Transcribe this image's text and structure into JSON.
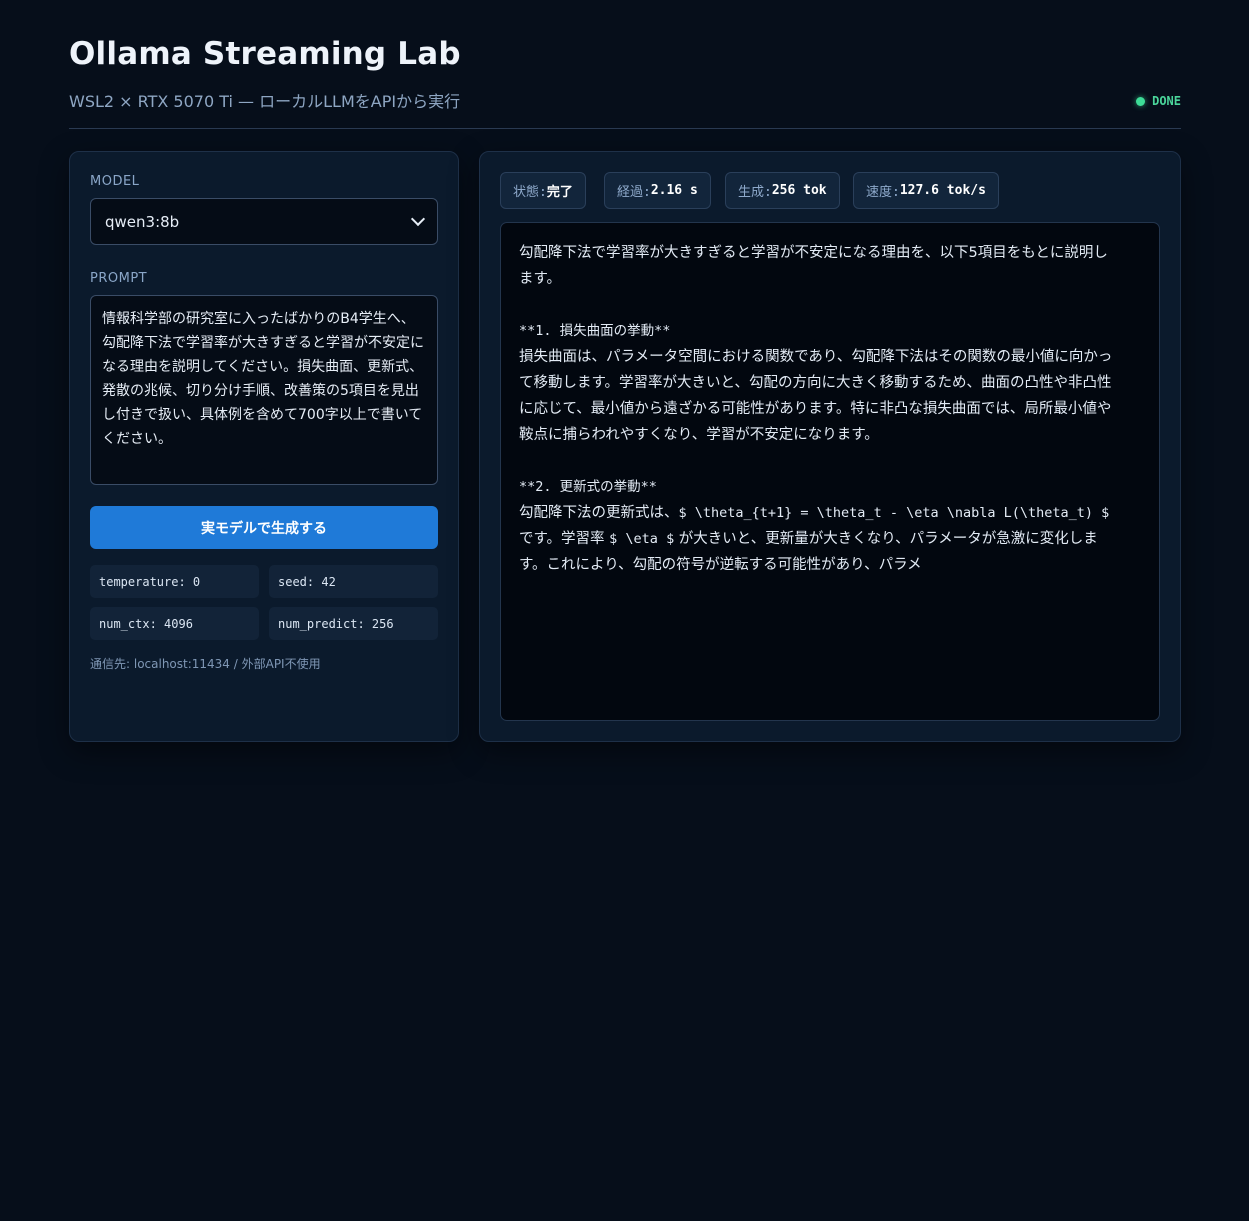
{
  "header": {
    "title": "Ollama Streaming Lab",
    "subtitle": "WSL2 × RTX 5070 Ti — ローカルLLMをAPIから実行",
    "status": "DONE"
  },
  "left": {
    "model_label": "MODEL",
    "model_value": "qwen3:8b",
    "prompt_label": "PROMPT",
    "prompt_lines": [
      "情報科学部の研究室に入ったばかりのB4学生へ、",
      "勾配降下法で学習率が大きすぎると学習が不安定に",
      "なる理由を説明してください。損失曲面、更新式、",
      "発散の兆候、切り分け手順、改善策の5項目を見出",
      "し付きで扱い、具体例を含めて700字以上で書いて",
      "ください。"
    ],
    "generate_button": "実モデルで生成する",
    "params": {
      "temperature": "temperature: 0",
      "seed": "seed: 42",
      "num_ctx": "num_ctx: 4096",
      "num_predict": "num_predict: 256"
    },
    "endpoint": "通信先: localhost:11434 / 外部API不使用"
  },
  "stats": {
    "state_key": "状態: ",
    "state_val": "完了",
    "elapsed_key": "経過: ",
    "elapsed_val": "2.16 s",
    "generated_key": "生成: ",
    "generated_val": "256 tok",
    "speed_key": "速度: ",
    "speed_val": "127.6 tok/s"
  },
  "output": {
    "intro_1": "勾配降下法で学習率が大きすぎると学習が不安定になる理由を、以下5項目をもとに説明し",
    "intro_2": "ます。",
    "h1": "**1. 損失曲面の挙動**",
    "p1_1": "損失曲面は、パラメータ空間における関数であり、勾配降下法はその関数の最小値に向かっ",
    "p1_2": "て移動します。学習率が大きいと、勾配の方向に大きく移動するため、曲面の凸性や非凸性",
    "p1_3": "に応じて、最小値から遠ざかる可能性があります。特に非凸な損失曲面では、局所最小値や",
    "p1_4": "鞍点に捕らわれやすくなり、学習が不安定になります。",
    "h2": "**2. 更新式の挙動**",
    "p2_1a": "勾配降下法の更新式は、",
    "p2_1b": "$ \\theta_{t+1} = \\theta_t - \\eta \\nabla L(\\theta_t) $",
    "p2_2a": "です。学習率 ",
    "p2_2b": "$ \\eta $",
    "p2_2c": " が大きいと、更新量が大きくなり、パラメータが急激に変化しま",
    "p2_3": "す。これにより、勾配の符号が逆転する可能性があり、パラメ"
  }
}
